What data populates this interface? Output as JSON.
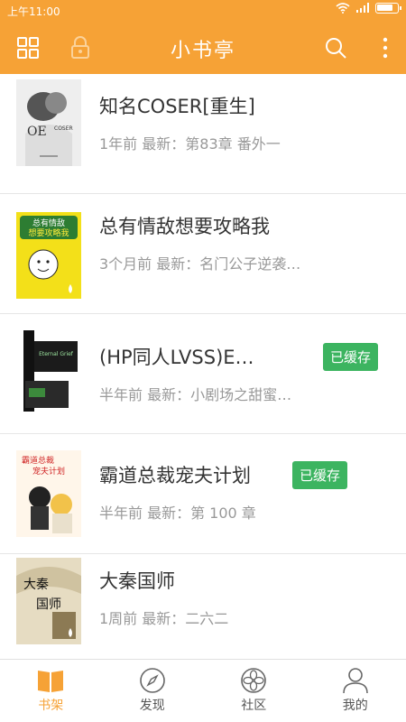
{
  "status_bar": {
    "time": "上午11:00",
    "battery": 0.85
  },
  "app_bar": {
    "title": "小书亭"
  },
  "books": [
    {
      "title": "知名COSER[重生]",
      "meta": "1年前 最新：第83章 番外一",
      "cached": false,
      "cached_label": ""
    },
    {
      "title": "总有情敌想要攻略我",
      "meta": "3个月前 最新：名门公子逆袭…",
      "cached": false,
      "cached_label": ""
    },
    {
      "title": "(HP同人LVSS)E…",
      "meta": "半年前 最新：小剧场之甜蜜…",
      "cached": true,
      "cached_label": "已缓存"
    },
    {
      "title": "霸道总裁宠夫计划",
      "meta": "半年前 最新：第 100 章",
      "cached": true,
      "cached_label": "已缓存"
    },
    {
      "title": "大秦国师",
      "meta": "1周前 最新：二六二",
      "cached": false,
      "cached_label": ""
    }
  ],
  "covers": [
    {
      "text": "OE",
      "sub": "COSER"
    },
    {
      "text": "总有情敌",
      "sub": "想要攻略我"
    },
    {
      "text": "Eternal Grief",
      "sub": ""
    },
    {
      "text": "霸道总裁",
      "sub": "宠夫计划"
    },
    {
      "text": "大秦",
      "sub": "国师"
    }
  ],
  "tabs": [
    {
      "label": "书架",
      "icon": "book-icon",
      "active": true
    },
    {
      "label": "发现",
      "icon": "compass-icon",
      "active": false
    },
    {
      "label": "社区",
      "icon": "community-icon",
      "active": false
    },
    {
      "label": "我的",
      "icon": "user-icon",
      "active": false
    }
  ],
  "colors": {
    "accent": "#f6a236",
    "cached_badge": "#3cb460"
  }
}
